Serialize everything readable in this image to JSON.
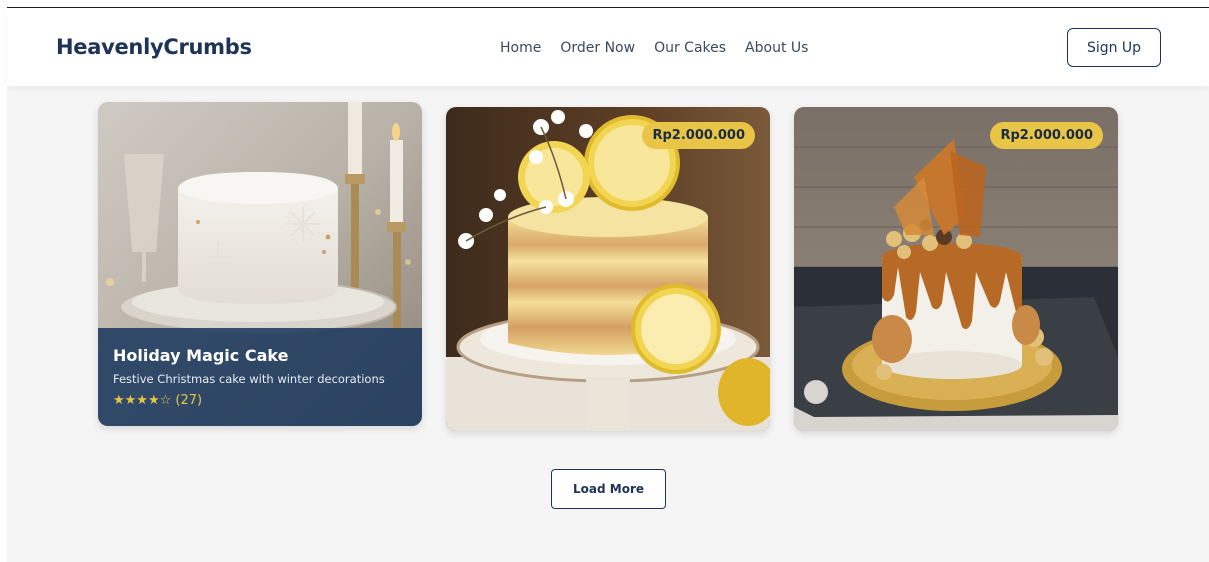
{
  "header": {
    "logo": "HeavenlyCrumbs",
    "nav": [
      "Home",
      "Order Now",
      "Our Cakes",
      "About Us"
    ],
    "signup_label": "Sign Up"
  },
  "cards": [
    {
      "title": "Holiday Magic Cake",
      "description": "Festive Christmas cake with winter decorations",
      "rating_text": "★★★★☆ (27)"
    },
    {
      "price": "Rp2.000.000"
    },
    {
      "price": "Rp2.000.000"
    }
  ],
  "load_more_label": "Load More",
  "colors": {
    "brand": "#1d3457",
    "price_badge": "#e8c547",
    "background": "#f5f5f5"
  }
}
